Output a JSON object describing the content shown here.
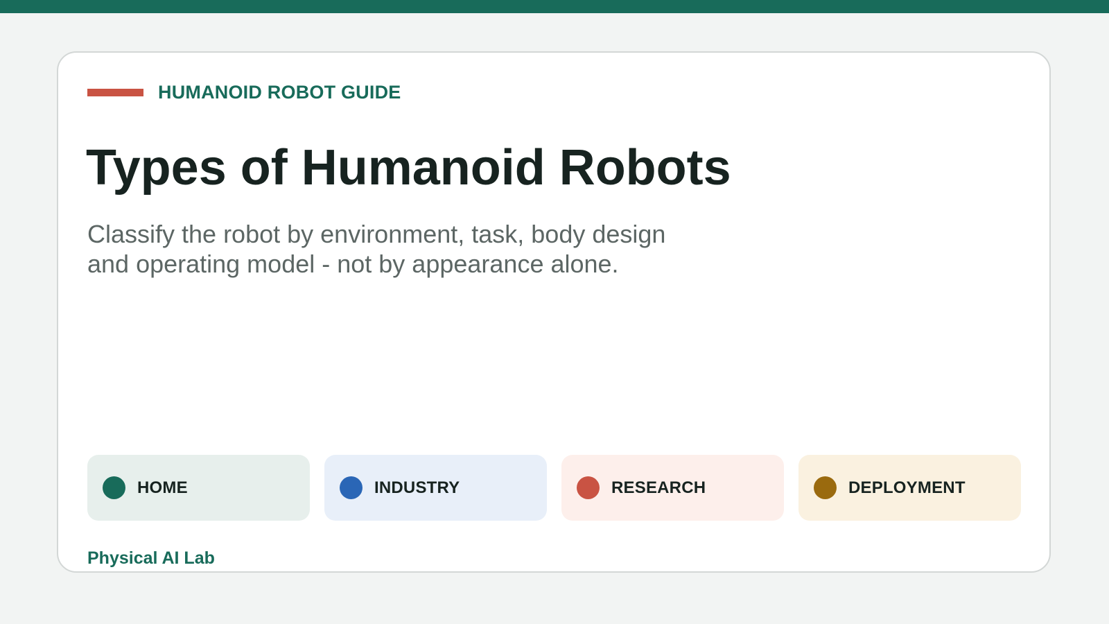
{
  "colors": {
    "top_bar": "#186b5a",
    "page_background": "#f2f4f3",
    "accent": "#c95343",
    "brand_green": "#186b5a",
    "title": "#172320",
    "subtitle": "#5c6664"
  },
  "header": {
    "eyebrow": "HUMANOID ROBOT GUIDE",
    "title": "Types of Humanoid Robots",
    "subtitle": "Classify the robot by environment, task, body design and operating model - not by appearance alone."
  },
  "categories": [
    {
      "label": "HOME",
      "dot_color": "#186b5a",
      "background": "#e7efec"
    },
    {
      "label": "INDUSTRY",
      "dot_color": "#2a66b6",
      "background": "#e8eff9"
    },
    {
      "label": "RESEARCH",
      "dot_color": "#c95343",
      "background": "#fdefeb"
    },
    {
      "label": "DEPLOYMENT",
      "dot_color": "#9a6a0e",
      "background": "#faf1e0"
    }
  ],
  "footer": {
    "brand": "Physical AI Lab"
  }
}
